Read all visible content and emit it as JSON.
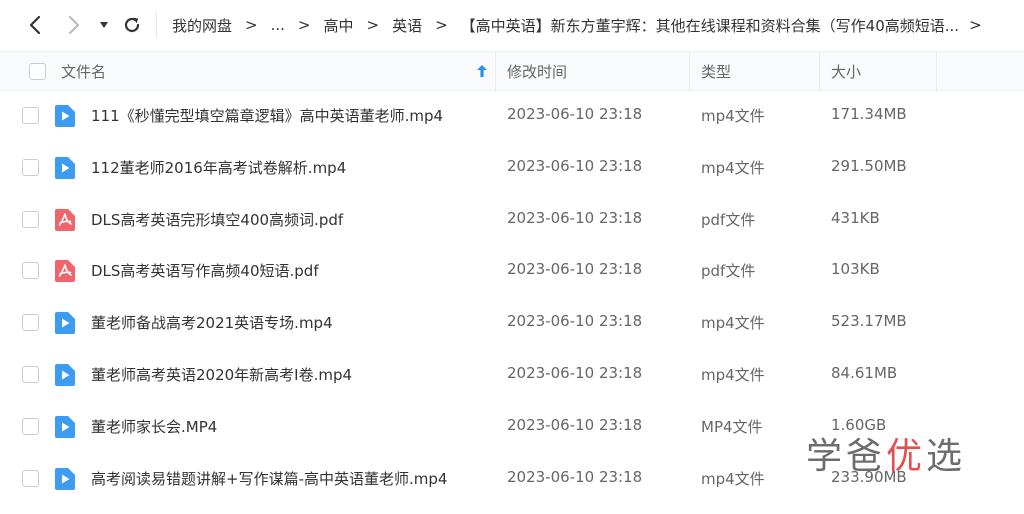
{
  "breadcrumb": {
    "root": "我的网盘",
    "ellipsis": "...",
    "level1": "高中",
    "level2": "英语",
    "current": "【高中英语】新东方董宇辉：其他在线课程和资料合集（写作40高频短语..."
  },
  "columns": {
    "name": "文件名",
    "modified": "修改时间",
    "type": "类型",
    "size": "大小"
  },
  "files": [
    {
      "name": "111《秒懂完型填空篇章逻辑》高中英语董老师.mp4",
      "modified": "2023-06-10 23:18",
      "type": "mp4文件",
      "size": "171.34MB",
      "icon": "video-file-icon"
    },
    {
      "name": "112董老师2016年高考试卷解析.mp4",
      "modified": "2023-06-10 23:18",
      "type": "mp4文件",
      "size": "291.50MB",
      "icon": "video-file-icon"
    },
    {
      "name": "DLS高考英语完形填空400高频词.pdf",
      "modified": "2023-06-10 23:18",
      "type": "pdf文件",
      "size": "431KB",
      "icon": "pdf-file-icon"
    },
    {
      "name": "DLS高考英语写作高频40短语.pdf",
      "modified": "2023-06-10 23:18",
      "type": "pdf文件",
      "size": "103KB",
      "icon": "pdf-file-icon"
    },
    {
      "name": "董老师备战高考2021英语专场.mp4",
      "modified": "2023-06-10 23:18",
      "type": "mp4文件",
      "size": "523.17MB",
      "icon": "video-file-icon"
    },
    {
      "name": "董老师高考英语2020年新高考I卷.mp4",
      "modified": "2023-06-10 23:18",
      "type": "mp4文件",
      "size": "84.61MB",
      "icon": "video-file-icon"
    },
    {
      "name": "董老师家长会.MP4",
      "modified": "2023-06-10 23:18",
      "type": "MP4文件",
      "size": "1.60GB",
      "icon": "video-file-icon"
    },
    {
      "name": "高考阅读易错题讲解+写作谋篇-高中英语董老师.mp4",
      "modified": "2023-06-10 23:18",
      "type": "mp4文件",
      "size": "233.90MB",
      "icon": "video-file-icon"
    }
  ],
  "watermark": {
    "part1": "学爸",
    "part2": "优",
    "part3": "选"
  },
  "colors": {
    "video_icon": "#3b9cf2",
    "pdf_icon": "#f0646b",
    "sort_arrow": "#2a8ff5",
    "watermark_red": "#e23b3b"
  }
}
